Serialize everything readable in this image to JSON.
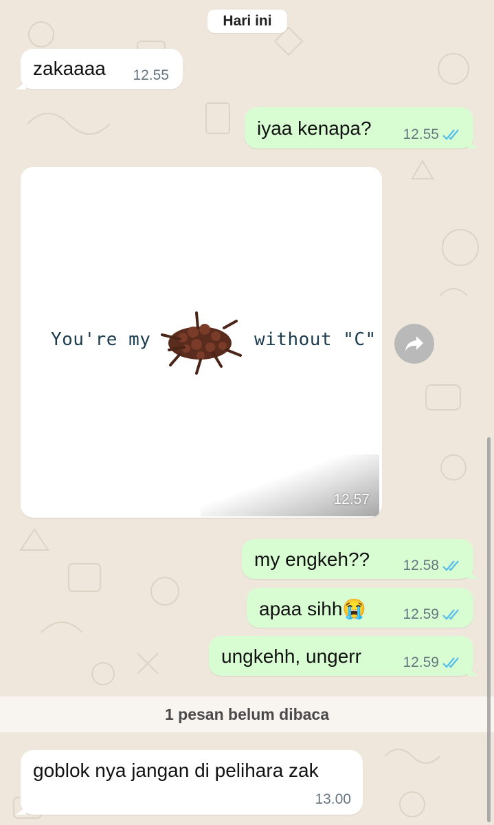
{
  "chat": {
    "date_divider": "Hari ini",
    "messages": [
      {
        "text": "zakaaaa",
        "time": "12.55",
        "direction": "in"
      },
      {
        "text": "iyaa kenapa?",
        "time": "12.55",
        "direction": "out",
        "status": "read"
      },
      {
        "type": "image",
        "caption_left": "You're my",
        "caption_right": "without \"C\"",
        "time": "12.57",
        "direction": "in"
      },
      {
        "text": "my engkeh??",
        "time": "12.58",
        "direction": "out",
        "status": "read"
      },
      {
        "text": "apaa sihh😭",
        "time": "12.59",
        "direction": "out",
        "status": "read"
      },
      {
        "text": "ungkehh, ungerr",
        "time": "12.59",
        "direction": "out",
        "status": "read"
      },
      {
        "text": "goblok nya jangan di pelihara zak",
        "time": "13.00",
        "direction": "in"
      }
    ],
    "unread_label": "1 pesan belum dibaca"
  },
  "icons": {
    "read_receipt": "double-check-icon",
    "forward": "forward-arrow-icon",
    "image_subject": "cloves-image"
  },
  "colors": {
    "wallpaper": "#efe7dc",
    "incoming_bubble": "#ffffff",
    "outgoing_bubble": "#d9fdd3",
    "read_tick": "#53bdeb",
    "meta_text": "#667781"
  }
}
